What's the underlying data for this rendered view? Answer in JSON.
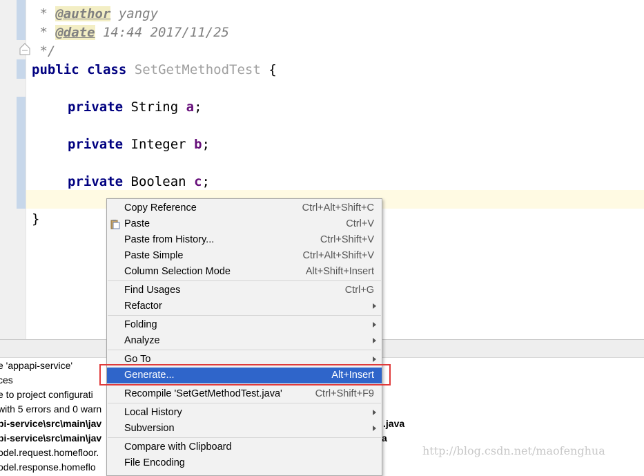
{
  "editor": {
    "lines": [
      {
        "type": "javadoc",
        "star": " * ",
        "tag": "@author",
        "text": " yangy"
      },
      {
        "type": "javadoc",
        "star": " * ",
        "tag": "@date",
        "text": " 14:44 2017/11/25"
      },
      {
        "type": "comment_end",
        "text": " */"
      },
      {
        "type": "class_decl",
        "kw1": "public",
        "kw2": "class",
        "name": "SetGetMethodTest",
        "brace": " {"
      },
      {
        "type": "field",
        "kw": "private",
        "typ": "String",
        "name": "a",
        "end": ";"
      },
      {
        "type": "field",
        "kw": "private",
        "typ": "Integer",
        "name": "b",
        "end": ";"
      },
      {
        "type": "field",
        "kw": "private",
        "typ": "Boolean",
        "name": "c",
        "end": ";"
      },
      {
        "type": "close",
        "text": "}"
      }
    ]
  },
  "bottom_panel": {
    "messages": [
      "e 'appapi-service'",
      "ces",
      "e to project configurati",
      "with 5 errors and 0 warn",
      "pi-service\\src\\main\\jav",
      "pi-service\\src\\main\\jav",
      "odel.request.homefloor.",
      "odel.response.homeflo"
    ],
    "trailing": [
      ".java",
      "a"
    ]
  },
  "context_menu": {
    "items": [
      {
        "label": "Copy Reference",
        "shortcut": "Ctrl+Alt+Shift+C"
      },
      {
        "label": "Paste",
        "shortcut": "Ctrl+V",
        "icon": "clipboard-icon"
      },
      {
        "label": "Paste from History...",
        "shortcut": "Ctrl+Shift+V"
      },
      {
        "label": "Paste Simple",
        "shortcut": "Ctrl+Alt+Shift+V"
      },
      {
        "label": "Column Selection Mode",
        "shortcut": "Alt+Shift+Insert"
      },
      {
        "label": "Find Usages",
        "shortcut": "Ctrl+G"
      },
      {
        "label": "Refactor",
        "submenu": true
      },
      {
        "label": "Folding",
        "submenu": true
      },
      {
        "label": "Analyze",
        "submenu": true
      },
      {
        "label": "Go To",
        "submenu": true
      },
      {
        "label": "Generate...",
        "shortcut": "Alt+Insert",
        "selected": true
      },
      {
        "label": "Recompile 'SetGetMethodTest.java'",
        "shortcut": "Ctrl+Shift+F9"
      },
      {
        "label": "Local History",
        "submenu": true
      },
      {
        "label": "Subversion",
        "submenu": true
      },
      {
        "label": "Compare with Clipboard"
      },
      {
        "label": "File Encoding"
      }
    ]
  },
  "watermark": "http://blog.csdn.net/maofenghua",
  "colors": {
    "selection": "#2f65ca",
    "highlight_box": "#e03a3a",
    "keyword": "#000080",
    "field": "#660e7a"
  }
}
